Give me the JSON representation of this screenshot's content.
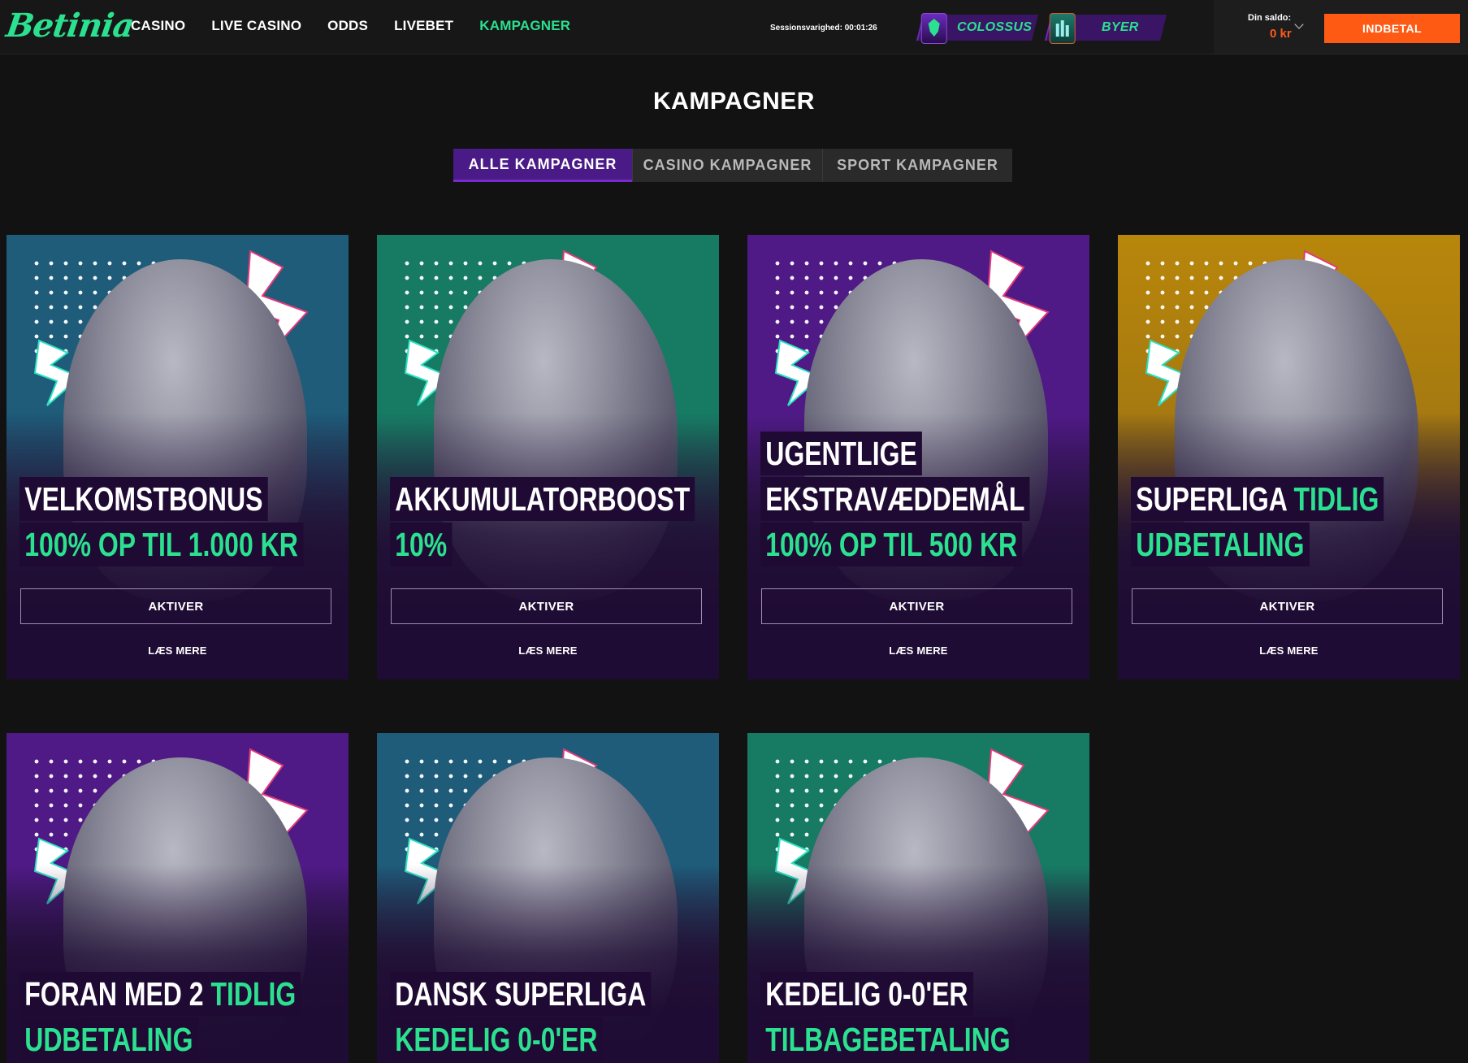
{
  "header": {
    "logo": "Betinia",
    "nav": [
      "CASINO",
      "LIVE CASINO",
      "ODDS",
      "LIVEBET",
      "KAMPAGNER"
    ],
    "session_label": "Sessionsvarighed: 00:01:26",
    "promo_tabs": [
      {
        "label": "COLOSSUS",
        "icon": "shield-badge-icon"
      },
      {
        "label": "BYER",
        "icon": "city-badge-icon"
      }
    ],
    "saldo_label": "Din saldo:",
    "saldo_value": "0 kr",
    "deposit_button": "INDBETAL"
  },
  "page": {
    "title": "KAMPAGNER",
    "filter_tabs": [
      "ALLE KAMPAGNER",
      "CASINO KAMPAGNER",
      "SPORT KAMPAGNER"
    ]
  },
  "colors": {
    "accent_green": "#2be08f",
    "deposit_orange": "#ff5a14",
    "purple": "#4a1a86"
  },
  "cards": [
    {
      "lines": [
        [
          {
            "t": "VELKOMSTBONUS",
            "c": "white"
          }
        ],
        [
          {
            "t": "100% OP TIL ",
            "c": "green"
          },
          {
            "t": "1.000 KR",
            "c": "green"
          }
        ]
      ],
      "button": "AKTIVER",
      "link": "LÆS MERE",
      "bg": "teal-blue",
      "statue": "gorilla"
    },
    {
      "lines": [
        [
          {
            "t": "AKKUMULATORBOOST",
            "c": "white"
          }
        ],
        [
          {
            "t": "10%",
            "c": "green"
          }
        ]
      ],
      "button": "AKTIVER",
      "link": "LÆS MERE",
      "bg": "green",
      "statue": "tiger"
    },
    {
      "lines": [
        [
          {
            "t": "UGENTLIGE",
            "c": "white"
          }
        ],
        [
          {
            "t": "EKSTRAVÆDDEMÅL",
            "c": "white"
          }
        ],
        [
          {
            "t": "100% OP TIL ",
            "c": "green"
          },
          {
            "t": "500 KR",
            "c": "green"
          }
        ]
      ],
      "button": "AKTIVER",
      "link": "LÆS MERE",
      "bg": "purple",
      "statue": "eagle"
    },
    {
      "lines": [
        [
          {
            "t": "SUPERLIGA ",
            "c": "white"
          },
          {
            "t": "TIDLIG",
            "c": "green"
          }
        ],
        [
          {
            "t": "UDBETALING",
            "c": "green"
          }
        ]
      ],
      "button": "AKTIVER",
      "link": "LÆS MERE",
      "bg": "gold",
      "statue": "bull"
    },
    {
      "lines": [
        [
          {
            "t": "FORAN MED 2 ",
            "c": "white"
          },
          {
            "t": "TIDLIG",
            "c": "green"
          }
        ],
        [
          {
            "t": "UDBETALING",
            "c": "green"
          }
        ]
      ],
      "bg": "purple",
      "statue": "eagle"
    },
    {
      "lines": [
        [
          {
            "t": "DANSK SUPERLIGA",
            "c": "white"
          }
        ],
        [
          {
            "t": "KEDELIG 0-0'ER",
            "c": "green"
          }
        ]
      ],
      "bg": "teal-blue",
      "statue": "boar"
    },
    {
      "lines": [
        [
          {
            "t": "KEDELIG 0-0'ER",
            "c": "white"
          }
        ],
        [
          {
            "t": "TILBAGEBETALING",
            "c": "green"
          }
        ]
      ],
      "bg": "green",
      "statue": "lion"
    }
  ]
}
